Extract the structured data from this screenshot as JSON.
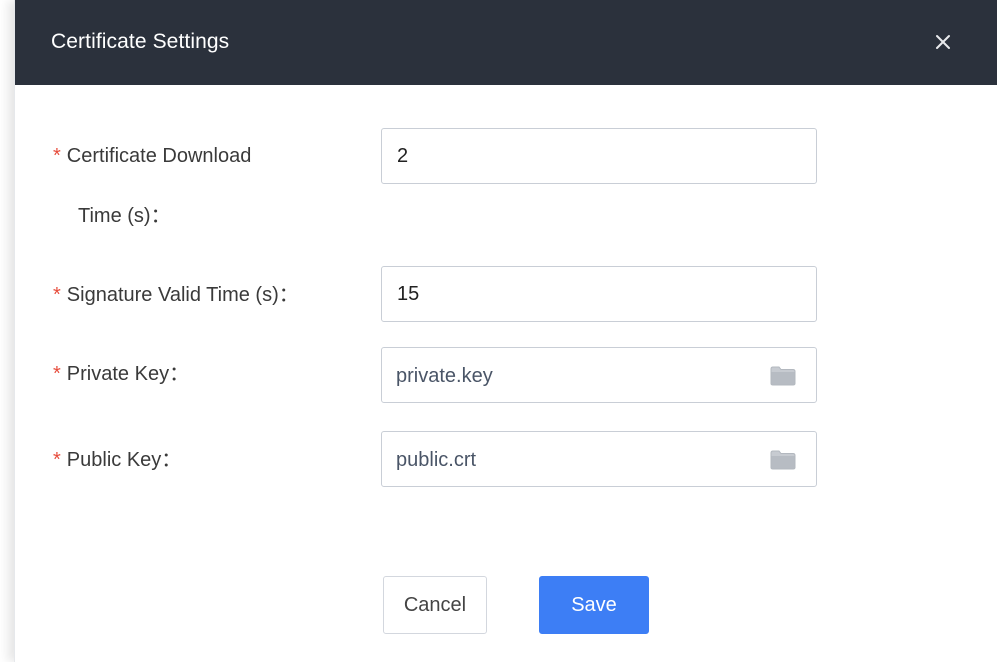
{
  "dialog": {
    "title": "Certificate Settings",
    "close_icon": "close-icon"
  },
  "fields": {
    "cert_download": {
      "required_mark": "*",
      "label_line1": "Certificate Download",
      "label_line2": "Time (s)：",
      "value": "2"
    },
    "signature_valid": {
      "required_mark": "*",
      "label": "Signature Valid Time (s)：",
      "value": "15"
    },
    "private_key": {
      "required_mark": "*",
      "label": "Private Key：",
      "file_name": "private.key",
      "icon": "folder-icon"
    },
    "public_key": {
      "required_mark": "*",
      "label": "Public Key：",
      "file_name": "public.crt",
      "icon": "folder-icon"
    }
  },
  "buttons": {
    "cancel": "Cancel",
    "save": "Save"
  },
  "colors": {
    "header_bg": "#2b313c",
    "required": "#e74c3c",
    "primary": "#3d7ef5"
  }
}
